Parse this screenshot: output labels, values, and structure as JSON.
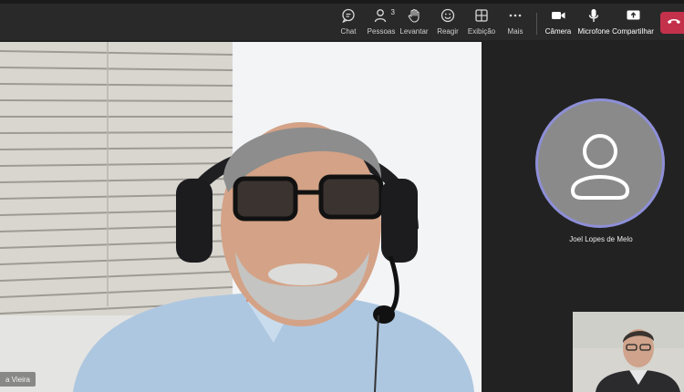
{
  "toolbar": {
    "chat_label": "Chat",
    "people_label": "Pessoas",
    "people_count": "3",
    "raise_label": "Levantar",
    "react_label": "Reagir",
    "view_label": "Exibição",
    "more_label": "Mais",
    "camera_label": "Câmera",
    "mic_label": "Microfone",
    "share_label": "Compartilhar"
  },
  "main_video": {
    "participant_name": "a Vieira"
  },
  "participants": {
    "avatar_name": "Joel Lopes de Melo"
  },
  "colors": {
    "toolbar_bg": "#292929",
    "stage_bg": "#222222",
    "leave_red": "#c4314b",
    "speaker_ring": "#8e8fd7"
  }
}
